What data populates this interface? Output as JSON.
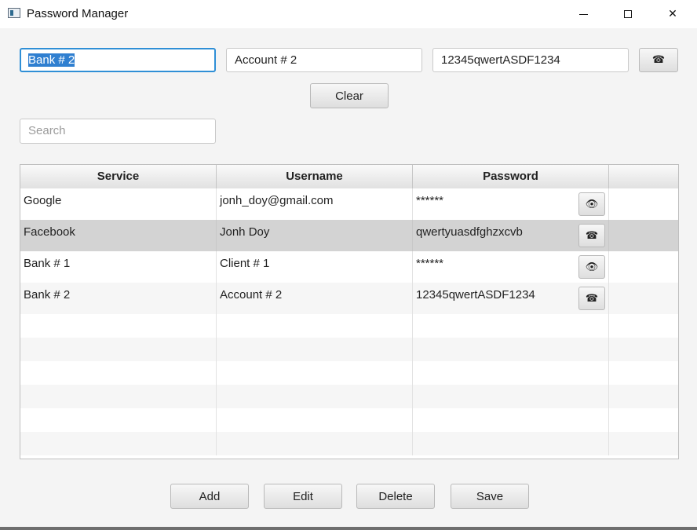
{
  "window": {
    "title": "Password Manager"
  },
  "form": {
    "service_value": "Bank # 2",
    "username_value": "Account # 2",
    "password_value": "12345qwertASDF1234",
    "toggle_icon": "☎",
    "clear_label": "Clear"
  },
  "search": {
    "placeholder": "Search"
  },
  "table": {
    "columns": [
      "Service",
      "Username",
      "Password"
    ],
    "rows": [
      {
        "service": "Google",
        "username": "jonh_doy@gmail.com",
        "password": "******",
        "icon": "👁",
        "icon_name": "eye-icon"
      },
      {
        "service": "Facebook",
        "username": "Jonh Doy",
        "password": "qwertyuasdfghzxcvb",
        "icon": "☎",
        "icon_name": "phone-icon"
      },
      {
        "service": "Bank # 1",
        "username": "Client # 1",
        "password": "******",
        "icon": "👁",
        "icon_name": "eye-icon"
      },
      {
        "service": "Bank # 2",
        "username": "Account # 2",
        "password": "12345qwertASDF1234",
        "icon": "☎",
        "icon_name": "phone-icon"
      }
    ],
    "selected_row": 1
  },
  "actions": {
    "add": "Add",
    "edit": "Edit",
    "delete": "Delete",
    "save": "Save"
  },
  "colors": {
    "accent": "#2f8fd6",
    "selected_row": "#d3d3d3",
    "selection": "#2f7fd0"
  }
}
